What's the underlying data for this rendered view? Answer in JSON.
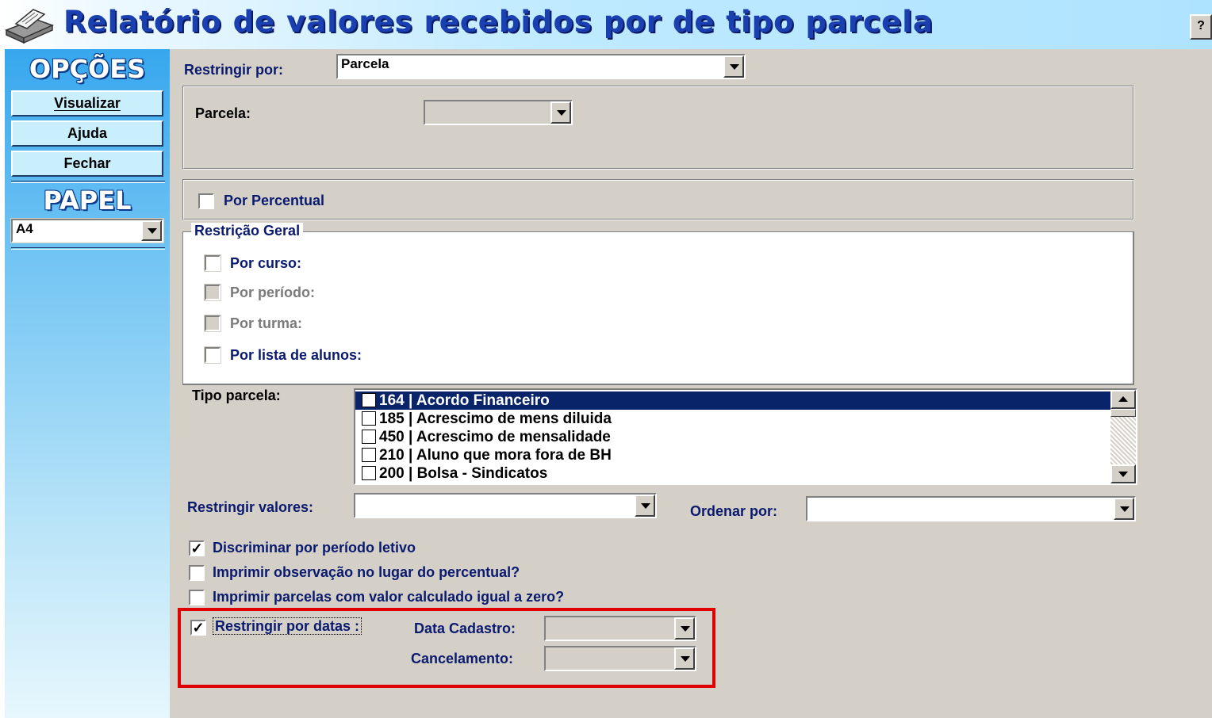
{
  "window": {
    "title": "Relatório de valores recebidos por de tipo parcela",
    "help_label": "?",
    "icon": "printer-icon"
  },
  "sidebar": {
    "options_heading": "OPÇÕES",
    "buttons": [
      {
        "label": "Visualizar",
        "mnemonic": "V"
      },
      {
        "label": "Ajuda",
        "mnemonic": "j"
      },
      {
        "label": "Fechar",
        "mnemonic": "F"
      }
    ],
    "paper_heading": "PAPEL",
    "paper_value": "A4"
  },
  "form": {
    "restrict_by_label": "Restringir por:",
    "restrict_by_value": "Parcela",
    "parcela_label": "Parcela:",
    "parcela_value": "",
    "by_percent_label": "Por Percentual",
    "by_percent_checked": false,
    "general_restriction": {
      "legend": "Restrição Geral",
      "items": [
        {
          "label": "Por curso:",
          "checked": false,
          "enabled": true
        },
        {
          "label": "Por período:",
          "checked": false,
          "enabled": false
        },
        {
          "label": "Por turma:",
          "checked": false,
          "enabled": false
        },
        {
          "label": "Por lista de alunos:",
          "checked": false,
          "enabled": true
        }
      ]
    },
    "tipo_parcela_label": "Tipo parcela:",
    "tipo_parcela_items": [
      {
        "code": "164",
        "name": "Acordo Financeiro",
        "selected": true
      },
      {
        "code": "185",
        "name": "Acrescimo de mens diluida",
        "selected": false
      },
      {
        "code": "450",
        "name": "Acrescimo de mensalidade",
        "selected": false
      },
      {
        "code": "210",
        "name": "Aluno que mora fora de BH",
        "selected": false
      },
      {
        "code": "200",
        "name": "Bolsa - Sindicatos",
        "selected": false
      }
    ],
    "tipo_parcela_rows_text": [
      "164 | Acordo Financeiro",
      "185 | Acrescimo de mens diluida",
      "450 | Acrescimo de mensalidade",
      "210 | Aluno que mora fora de BH",
      "200 | Bolsa - Sindicatos"
    ],
    "restrict_values_label": "Restringir valores:",
    "restrict_values_value": "",
    "order_by_label": "Ordenar por:",
    "order_by_value": "",
    "options": [
      {
        "label": "Discriminar por período letivo",
        "checked": true
      },
      {
        "label": "Imprimir observação no lugar do percentual?",
        "checked": false
      },
      {
        "label": "Imprimir parcelas com valor calculado igual a zero?",
        "checked": false
      }
    ],
    "date_restriction": {
      "label": "Restringir por datas :",
      "checked": true,
      "cadastro_label": "Data Cadastro:",
      "cadastro_value": "",
      "cancel_label": "Cancelamento:",
      "cancel_value": ""
    }
  },
  "colors": {
    "label_text": "#0a1a6e",
    "selection": "#0a246a",
    "highlight_box": "#e00000",
    "sidebar_top": "#37a7ee"
  }
}
